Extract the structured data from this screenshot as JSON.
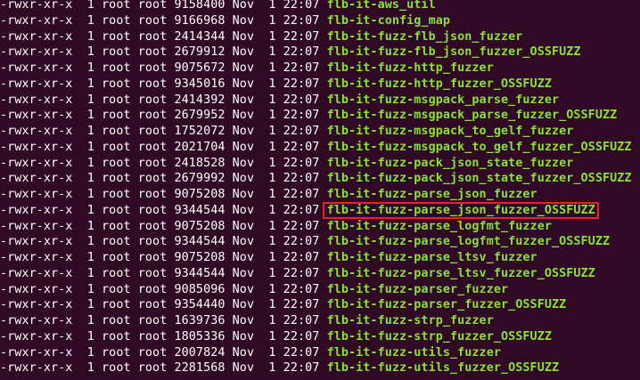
{
  "terminal": {
    "entries": [
      {
        "perms": "-rwxr-xr-x",
        "links": "1",
        "owner": "root",
        "group": "root",
        "size": "9158400",
        "month": "Nov",
        "day": "1",
        "time": "22:07",
        "name": "flb-it-aws_util",
        "highlighted": false
      },
      {
        "perms": "-rwxr-xr-x",
        "links": "1",
        "owner": "root",
        "group": "root",
        "size": "9166968",
        "month": "Nov",
        "day": "1",
        "time": "22:07",
        "name": "flb-it-config_map",
        "highlighted": false
      },
      {
        "perms": "-rwxr-xr-x",
        "links": "1",
        "owner": "root",
        "group": "root",
        "size": "2414344",
        "month": "Nov",
        "day": "1",
        "time": "22:07",
        "name": "flb-it-fuzz-flb_json_fuzzer",
        "highlighted": false
      },
      {
        "perms": "-rwxr-xr-x",
        "links": "1",
        "owner": "root",
        "group": "root",
        "size": "2679912",
        "month": "Nov",
        "day": "1",
        "time": "22:07",
        "name": "flb-it-fuzz-flb_json_fuzzer_OSSFUZZ",
        "highlighted": false
      },
      {
        "perms": "-rwxr-xr-x",
        "links": "1",
        "owner": "root",
        "group": "root",
        "size": "9075672",
        "month": "Nov",
        "day": "1",
        "time": "22:07",
        "name": "flb-it-fuzz-http_fuzzer",
        "highlighted": false
      },
      {
        "perms": "-rwxr-xr-x",
        "links": "1",
        "owner": "root",
        "group": "root",
        "size": "9345016",
        "month": "Nov",
        "day": "1",
        "time": "22:07",
        "name": "flb-it-fuzz-http_fuzzer_OSSFUZZ",
        "highlighted": false
      },
      {
        "perms": "-rwxr-xr-x",
        "links": "1",
        "owner": "root",
        "group": "root",
        "size": "2414392",
        "month": "Nov",
        "day": "1",
        "time": "22:07",
        "name": "flb-it-fuzz-msgpack_parse_fuzzer",
        "highlighted": false
      },
      {
        "perms": "-rwxr-xr-x",
        "links": "1",
        "owner": "root",
        "group": "root",
        "size": "2679952",
        "month": "Nov",
        "day": "1",
        "time": "22:07",
        "name": "flb-it-fuzz-msgpack_parse_fuzzer_OSSFUZZ",
        "highlighted": false
      },
      {
        "perms": "-rwxr-xr-x",
        "links": "1",
        "owner": "root",
        "group": "root",
        "size": "1752072",
        "month": "Nov",
        "day": "1",
        "time": "22:07",
        "name": "flb-it-fuzz-msgpack_to_gelf_fuzzer",
        "highlighted": false
      },
      {
        "perms": "-rwxr-xr-x",
        "links": "1",
        "owner": "root",
        "group": "root",
        "size": "2021704",
        "month": "Nov",
        "day": "1",
        "time": "22:07",
        "name": "flb-it-fuzz-msgpack_to_gelf_fuzzer_OSSFUZZ",
        "highlighted": false
      },
      {
        "perms": "-rwxr-xr-x",
        "links": "1",
        "owner": "root",
        "group": "root",
        "size": "2418528",
        "month": "Nov",
        "day": "1",
        "time": "22:07",
        "name": "flb-it-fuzz-pack_json_state_fuzzer",
        "highlighted": false
      },
      {
        "perms": "-rwxr-xr-x",
        "links": "1",
        "owner": "root",
        "group": "root",
        "size": "2679992",
        "month": "Nov",
        "day": "1",
        "time": "22:07",
        "name": "flb-it-fuzz-pack_json_state_fuzzer_OSSFUZZ",
        "highlighted": false
      },
      {
        "perms": "-rwxr-xr-x",
        "links": "1",
        "owner": "root",
        "group": "root",
        "size": "9075208",
        "month": "Nov",
        "day": "1",
        "time": "22:07",
        "name": "flb-it-fuzz-parse_json_fuzzer",
        "highlighted": false
      },
      {
        "perms": "-rwxr-xr-x",
        "links": "1",
        "owner": "root",
        "group": "root",
        "size": "9344544",
        "month": "Nov",
        "day": "1",
        "time": "22:07",
        "name": "flb-it-fuzz-parse_json_fuzzer_OSSFUZZ",
        "highlighted": true
      },
      {
        "perms": "-rwxr-xr-x",
        "links": "1",
        "owner": "root",
        "group": "root",
        "size": "9075208",
        "month": "Nov",
        "day": "1",
        "time": "22:07",
        "name": "flb-it-fuzz-parse_logfmt_fuzzer",
        "highlighted": false
      },
      {
        "perms": "-rwxr-xr-x",
        "links": "1",
        "owner": "root",
        "group": "root",
        "size": "9344544",
        "month": "Nov",
        "day": "1",
        "time": "22:07",
        "name": "flb-it-fuzz-parse_logfmt_fuzzer_OSSFUZZ",
        "highlighted": false
      },
      {
        "perms": "-rwxr-xr-x",
        "links": "1",
        "owner": "root",
        "group": "root",
        "size": "9075208",
        "month": "Nov",
        "day": "1",
        "time": "22:07",
        "name": "flb-it-fuzz-parse_ltsv_fuzzer",
        "highlighted": false
      },
      {
        "perms": "-rwxr-xr-x",
        "links": "1",
        "owner": "root",
        "group": "root",
        "size": "9344544",
        "month": "Nov",
        "day": "1",
        "time": "22:07",
        "name": "flb-it-fuzz-parse_ltsv_fuzzer_OSSFUZZ",
        "highlighted": false
      },
      {
        "perms": "-rwxr-xr-x",
        "links": "1",
        "owner": "root",
        "group": "root",
        "size": "9085096",
        "month": "Nov",
        "day": "1",
        "time": "22:07",
        "name": "flb-it-fuzz-parser_fuzzer",
        "highlighted": false
      },
      {
        "perms": "-rwxr-xr-x",
        "links": "1",
        "owner": "root",
        "group": "root",
        "size": "9354440",
        "month": "Nov",
        "day": "1",
        "time": "22:07",
        "name": "flb-it-fuzz-parser_fuzzer_OSSFUZZ",
        "highlighted": false
      },
      {
        "perms": "-rwxr-xr-x",
        "links": "1",
        "owner": "root",
        "group": "root",
        "size": "1639736",
        "month": "Nov",
        "day": "1",
        "time": "22:07",
        "name": "flb-it-fuzz-strp_fuzzer",
        "highlighted": false
      },
      {
        "perms": "-rwxr-xr-x",
        "links": "1",
        "owner": "root",
        "group": "root",
        "size": "1805336",
        "month": "Nov",
        "day": "1",
        "time": "22:07",
        "name": "flb-it-fuzz-strp_fuzzer_OSSFUZZ",
        "highlighted": false
      },
      {
        "perms": "-rwxr-xr-x",
        "links": "1",
        "owner": "root",
        "group": "root",
        "size": "2007824",
        "month": "Nov",
        "day": "1",
        "time": "22:07",
        "name": "flb-it-fuzz-utils_fuzzer",
        "highlighted": false
      },
      {
        "perms": "-rwxr-xr-x",
        "links": "1",
        "owner": "root",
        "group": "root",
        "size": "2281568",
        "month": "Nov",
        "day": "1",
        "time": "22:07",
        "name": "flb-it-fuzz-utils_fuzzer_OSSFUZZ",
        "highlighted": false
      }
    ],
    "colors": {
      "background": "#300a24",
      "text": "#ffffff",
      "executable": "#8ae234",
      "highlight_border": "#e0262b"
    }
  }
}
